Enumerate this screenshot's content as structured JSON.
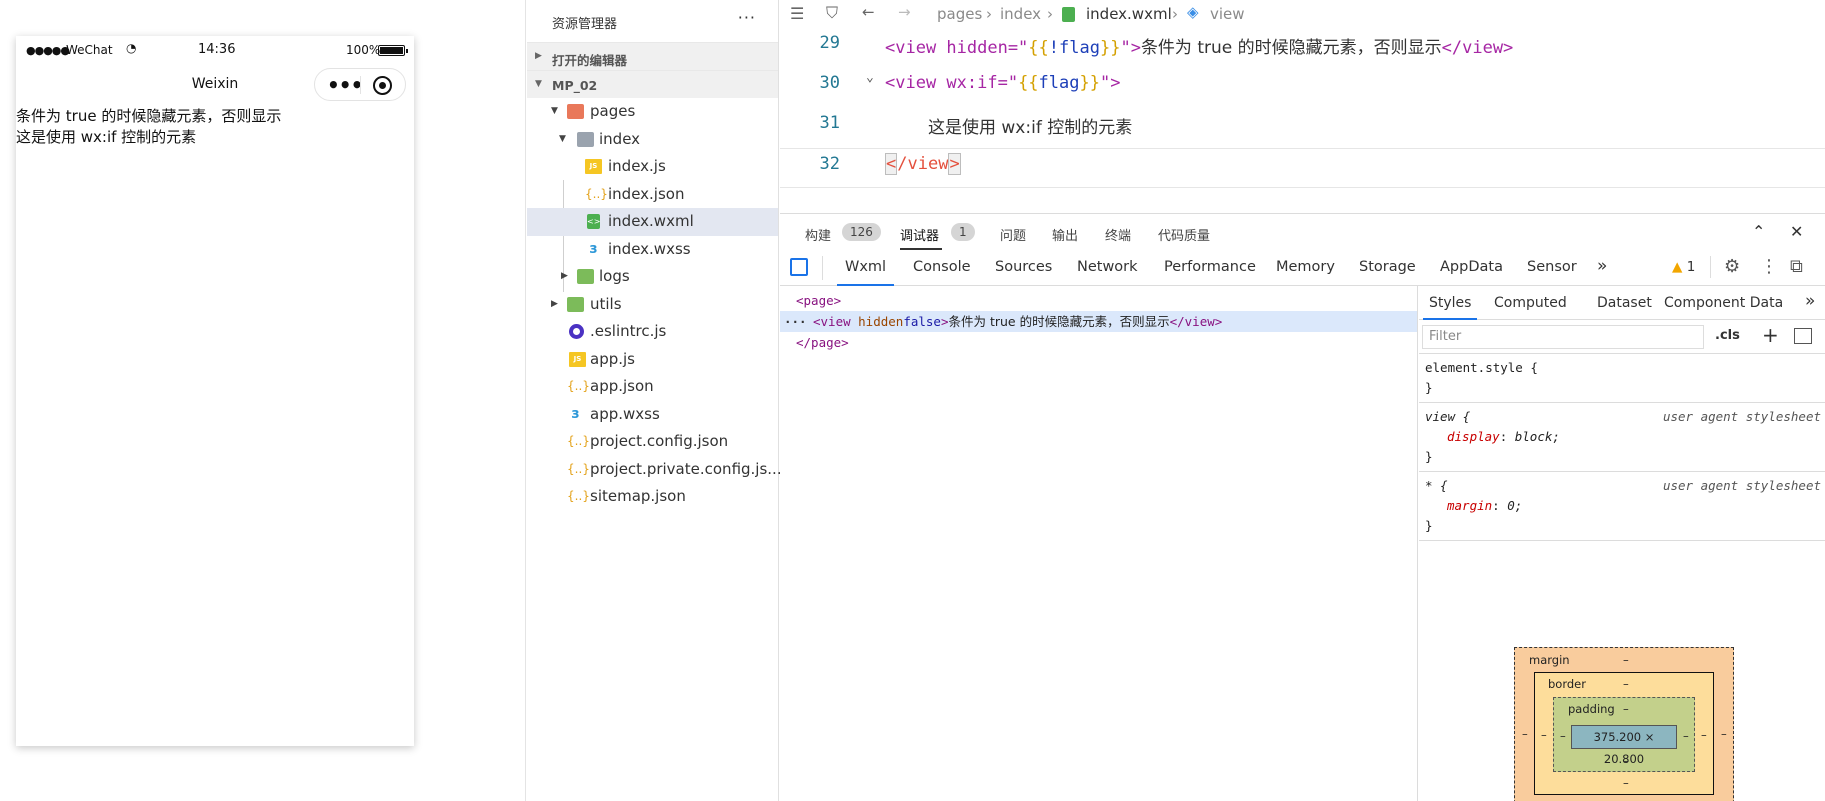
{
  "simulator": {
    "status": {
      "signal": "●●●●●",
      "carrier": "WeChat",
      "time": "14:36",
      "battery_pct": "100%"
    },
    "nav_title": "Weixin",
    "content_lines": [
      "条件为 true 的时候隐藏元素，否则显示",
      "这是使用 wx:if 控制的元素"
    ]
  },
  "explorer": {
    "title": "资源管理器",
    "more": "···",
    "open_editors": "打开的编辑器",
    "project": "MP_02",
    "tree": [
      {
        "name": "pages",
        "icon": "folder-red-icon"
      },
      {
        "name": "index",
        "icon": "folder-open-icon"
      },
      {
        "name": "index.js",
        "icon": "js-file-icon"
      },
      {
        "name": "index.json",
        "icon": "json-file-icon"
      },
      {
        "name": "index.wxml",
        "icon": "wxml-file-icon"
      },
      {
        "name": "index.wxss",
        "icon": "css-file-icon"
      },
      {
        "name": "logs",
        "icon": "folder-grey-icon"
      },
      {
        "name": "utils",
        "icon": "folder-green-icon"
      },
      {
        "name": ".eslintrc.js",
        "icon": "eslint-icon"
      },
      {
        "name": "app.js",
        "icon": "js-file-icon"
      },
      {
        "name": "app.json",
        "icon": "json-file-icon"
      },
      {
        "name": "app.wxss",
        "icon": "css-file-icon"
      },
      {
        "name": "project.config.json",
        "icon": "json-file-icon"
      },
      {
        "name": "project.private.config.js...",
        "icon": "json-file-icon"
      },
      {
        "name": "sitemap.json",
        "icon": "json-file-icon"
      }
    ]
  },
  "editor": {
    "breadcrumb": [
      "pages",
      "index",
      "index.wxml",
      "view"
    ],
    "lines": [
      {
        "num": "29",
        "text_a": "<view hidden=\"",
        "brace_open": "{{",
        "var": "!flag",
        "brace_close": "}}",
        "text_b": "\">",
        "content": "条件为 true 的时候隐藏元素，否则显示",
        "end": "</view>"
      },
      {
        "num": "30",
        "text_a": "<view wx:if=\"",
        "brace_open": "{{",
        "var": "flag",
        "brace_close": "}}",
        "text_b": "\">"
      },
      {
        "num": "31",
        "content": "这是使用 wx:if 控制的元素"
      },
      {
        "num": "32",
        "end_open": "<",
        "end_mid": "/view",
        "end_close": ">"
      }
    ]
  },
  "devtools": {
    "top_tabs": {
      "build": "构建",
      "build_count": "126",
      "debugger": "调试器",
      "debugger_count": "1",
      "issues": "问题",
      "output": "输出",
      "terminal": "终端",
      "quality": "代码质量"
    },
    "tabs": [
      "Wxml",
      "Console",
      "Sources",
      "Network",
      "Performance",
      "Memory",
      "Storage",
      "AppData",
      "Sensor"
    ],
    "more_tabs": "»",
    "warning_count": "1",
    "dom": {
      "page_open": "<page>",
      "view_open": "<view ",
      "view_attr": "hidden",
      "view_attr_val": "false",
      "view_close_bracket": ">",
      "view_text": "条件为 true 的时候隐藏元素，否则显示",
      "view_end": "</view>",
      "page_close": "</page>",
      "ellipsis": "···"
    },
    "styles": {
      "tabs": [
        "Styles",
        "Computed",
        "Dataset",
        "Component Data"
      ],
      "more": "»",
      "filter_placeholder": "Filter",
      "cls": ".cls",
      "plus": "+",
      "rules": [
        {
          "selector": "element.style {",
          "close": "}",
          "source": "",
          "prop": "",
          "value": ""
        },
        {
          "selector": "view {",
          "close": "}",
          "source": "user agent stylesheet",
          "prop": "display",
          "value": "block;"
        },
        {
          "selector": "* {",
          "close": "}",
          "source": "user agent stylesheet",
          "prop": "margin",
          "value": "0;"
        }
      ],
      "box_model": {
        "margin_label": "margin",
        "border_label": "border",
        "padding_label": "padding",
        "content": "375.200 × 20.800",
        "dash": "–"
      }
    }
  }
}
